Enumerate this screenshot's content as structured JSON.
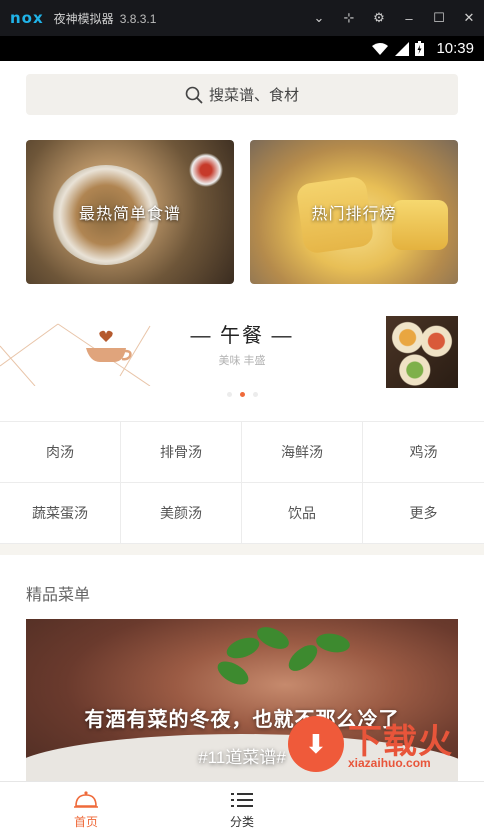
{
  "emulator": {
    "logo": "nox",
    "title": "夜神模拟器",
    "version": "3.8.3.1",
    "controls": [
      "chevron-down-icon",
      "pin-icon",
      "gear-icon",
      "minimize-icon",
      "maximize-icon",
      "close-icon"
    ]
  },
  "status_bar": {
    "time": "10:39"
  },
  "search": {
    "placeholder": "搜菜谱、食材"
  },
  "heroes": [
    {
      "label": "最热简单食谱"
    },
    {
      "label": "热门排行榜"
    }
  ],
  "meal_banner": {
    "title": "— 午餐 —",
    "subtitle": "美味 丰盛",
    "dots_count": 3,
    "active_dot": 1
  },
  "categories": [
    "肉汤",
    "排骨汤",
    "海鲜汤",
    "鸡汤",
    "蔬菜蛋汤",
    "美颜汤",
    "饮品",
    "更多"
  ],
  "section": {
    "title": "精品菜单"
  },
  "feature": {
    "title": "有酒有菜的冬夜，也就不那么冷了",
    "subtitle": "#11道菜谱#"
  },
  "bottom_nav": [
    {
      "label": "首页",
      "active": true,
      "icon": "home-dome-icon"
    },
    {
      "label": "分类",
      "active": false,
      "icon": "list-icon"
    }
  ],
  "watermark": {
    "text": "下载火",
    "url": "xiazaihuo.com"
  },
  "colors": {
    "accent": "#ef6a3a",
    "band": "#f6f4ef"
  }
}
